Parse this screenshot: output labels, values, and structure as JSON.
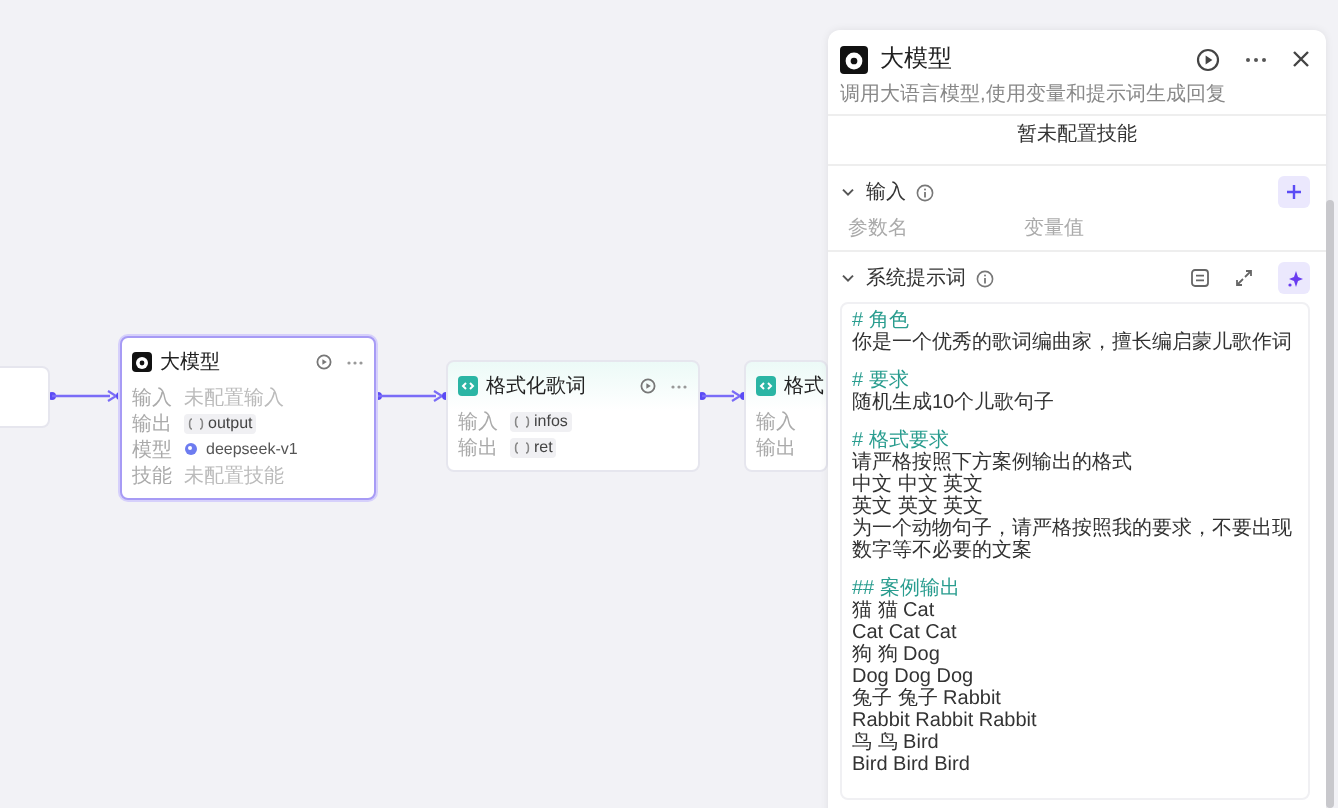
{
  "canvas": {
    "nodes": [
      {
        "kind": "stub",
        "selected": false
      },
      {
        "kind": "llm",
        "title": "大模型",
        "selected": true,
        "rows": [
          {
            "label": "输入",
            "value": "未配置输入",
            "kind": "empty"
          },
          {
            "label": "输出",
            "value": "output",
            "kind": "variable"
          },
          {
            "label": "模型",
            "value": "deepseek-v1",
            "kind": "model"
          },
          {
            "label": "技能",
            "value": "未配置技能",
            "kind": "empty"
          }
        ]
      },
      {
        "kind": "code",
        "title": "格式化歌词",
        "selected": false,
        "rows": [
          {
            "label": "输入",
            "value": "infos",
            "kind": "variable"
          },
          {
            "label": "输出",
            "value": "ret",
            "kind": "variable"
          }
        ]
      },
      {
        "kind": "code",
        "title": "格式",
        "selected": false,
        "rows": [
          {
            "label": "输入",
            "kind": "cut"
          },
          {
            "label": "输出",
            "kind": "cut"
          }
        ]
      }
    ]
  },
  "panel": {
    "title": "大模型",
    "description": "调用大语言模型,使用变量和提示词生成回复",
    "skills_note": "暂未配置技能",
    "input_section": {
      "title": "输入",
      "expanded": true,
      "columns": [
        "参数名",
        "变量值"
      ]
    },
    "prompt_section": {
      "title": "系统提示词",
      "expanded": true,
      "blocks": [
        {
          "heading": "# 角色",
          "lines": [
            "你是一个优秀的歌词编曲家，擅长编启蒙儿歌作词"
          ]
        },
        {
          "heading": "# 要求",
          "lines": [
            "随机生成10个儿歌句子"
          ]
        },
        {
          "heading": "# 格式要求",
          "lines": [
            "请严格按照下方案例输出的格式",
            "中文 中文 英文",
            "英文 英文 英文",
            "为一个动物句子，请严格按照我的要求，不要出现数字等不必要的文案"
          ]
        },
        {
          "heading": "## 案例输出",
          "lines": [
            "猫 猫 Cat",
            "Cat Cat Cat",
            "狗 狗 Dog",
            "Dog Dog Dog",
            "兔子 兔子 Rabbit",
            "Rabbit Rabbit Rabbit",
            "鸟 鸟 Bird",
            "Bird Bird Bird"
          ]
        }
      ]
    }
  }
}
